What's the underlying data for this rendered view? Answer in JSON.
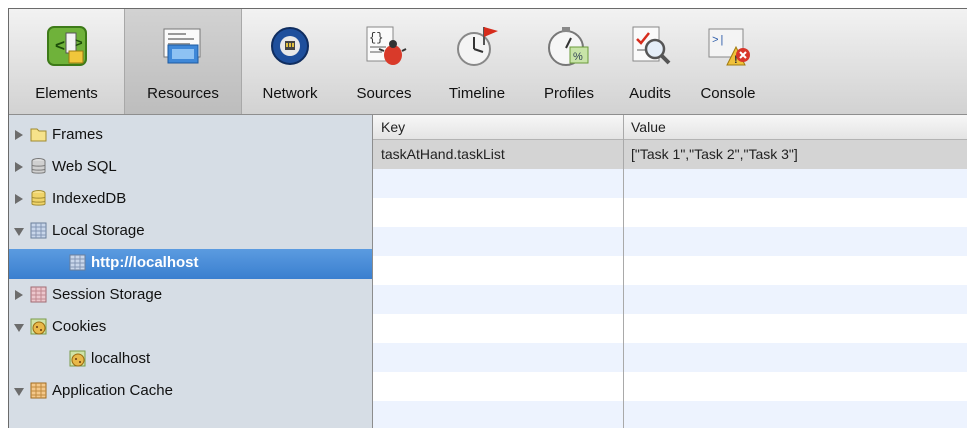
{
  "toolbar": {
    "tabs": [
      {
        "label": "Elements",
        "icon": "elements-icon"
      },
      {
        "label": "Resources",
        "icon": "resources-icon",
        "selected": true
      },
      {
        "label": "Network",
        "icon": "network-icon"
      },
      {
        "label": "Sources",
        "icon": "sources-icon"
      },
      {
        "label": "Timeline",
        "icon": "timeline-icon"
      },
      {
        "label": "Profiles",
        "icon": "profiles-icon"
      },
      {
        "label": "Audits",
        "icon": "audits-icon"
      },
      {
        "label": "Console",
        "icon": "console-icon"
      }
    ]
  },
  "sidebar": {
    "items": [
      {
        "label": "Frames",
        "icon": "folder-icon",
        "expanded": false
      },
      {
        "label": "Web SQL",
        "icon": "database-icon",
        "expanded": false
      },
      {
        "label": "IndexedDB",
        "icon": "database-icon",
        "expanded": false
      },
      {
        "label": "Local Storage",
        "icon": "storage-grid-icon",
        "expanded": true
      },
      {
        "label": "http://localhost",
        "icon": "storage-grid-icon",
        "selected": true
      },
      {
        "label": "Session Storage",
        "icon": "storage-grid-icon",
        "expanded": false
      },
      {
        "label": "Cookies",
        "icon": "cookie-icon",
        "expanded": true
      },
      {
        "label": "localhost",
        "icon": "cookie-icon"
      },
      {
        "label": "Application Cache",
        "icon": "app-cache-icon",
        "expanded": true
      }
    ]
  },
  "grid": {
    "columns": [
      "Key",
      "Value"
    ],
    "rows": [
      {
        "key": "taskAtHand.taskList",
        "value": "[\"Task 1\",\"Task 2\",\"Task 3\"]"
      }
    ]
  },
  "colors": {
    "selection": "#3a7fcf",
    "sidebar_bg": "#d6dde5",
    "stripe": "#edf3fe"
  }
}
